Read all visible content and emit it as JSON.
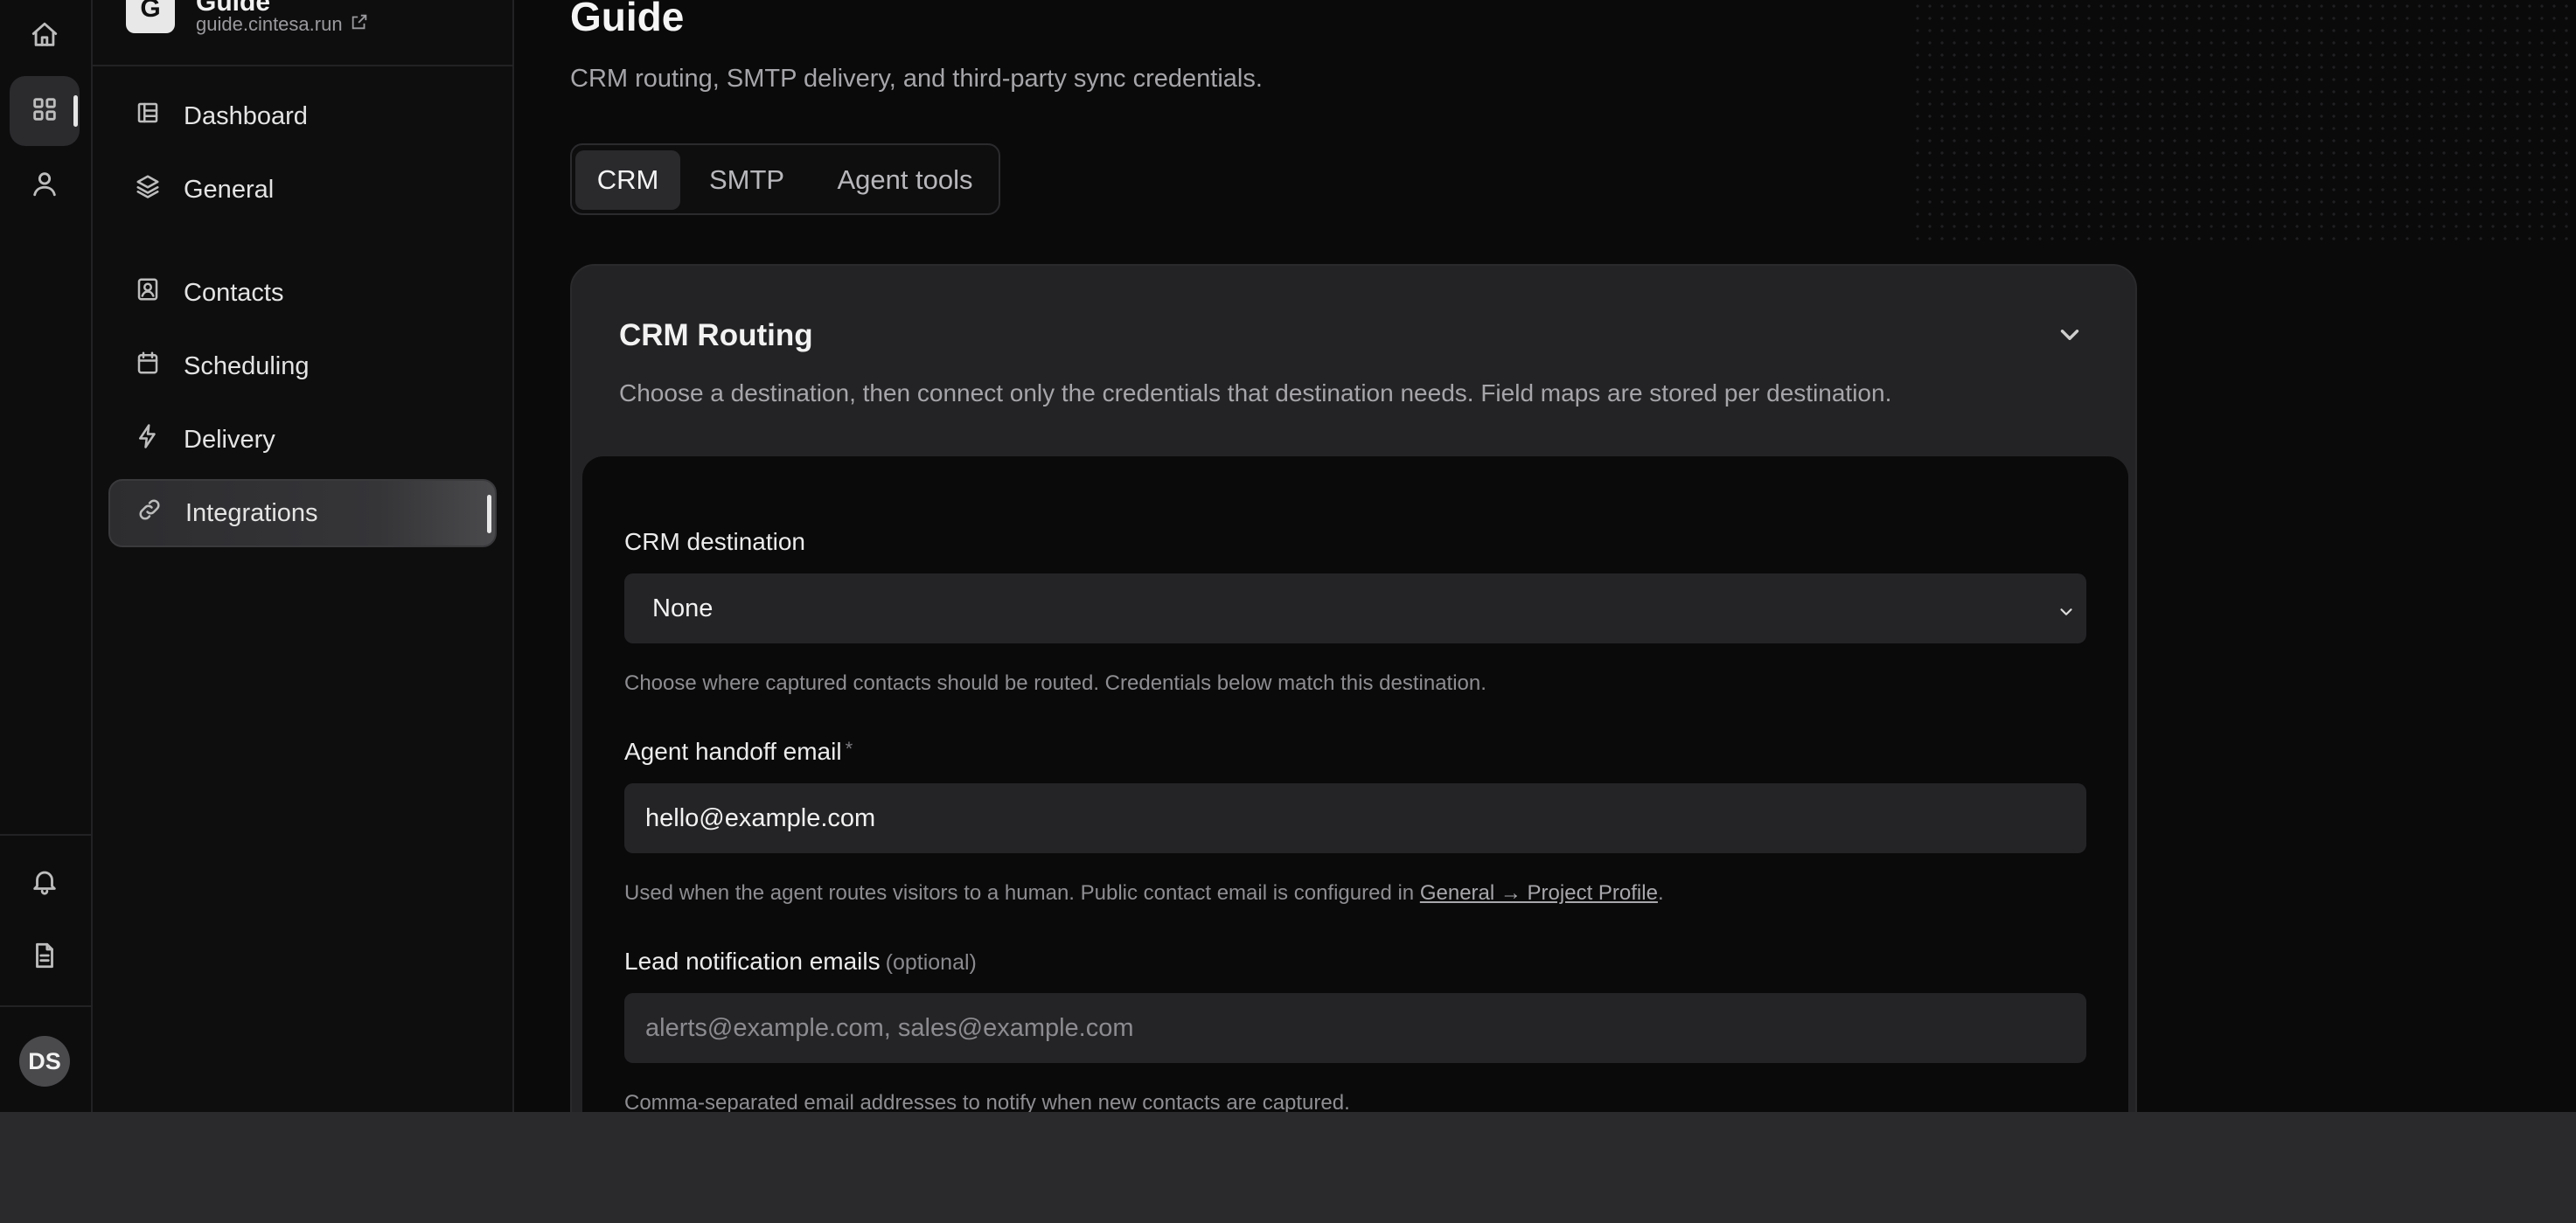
{
  "rail": {
    "avatar_initials": "DS",
    "icons": [
      "home-icon",
      "grid-icon",
      "user-icon",
      "bell-icon",
      "document-icon"
    ]
  },
  "sidebar": {
    "site_name": "Guide",
    "site_url": "guide.cintesa.run",
    "logo_text": "G",
    "items": [
      {
        "label": "Dashboard",
        "icon": "dashboard-icon"
      },
      {
        "label": "General",
        "icon": "layers-icon"
      },
      {
        "label": "Contacts",
        "icon": "contact-icon"
      },
      {
        "label": "Scheduling",
        "icon": "calendar-icon"
      },
      {
        "label": "Delivery",
        "icon": "bolt-icon"
      },
      {
        "label": "Integrations",
        "icon": "link-icon",
        "active": true
      }
    ]
  },
  "main": {
    "title": "Guide",
    "subtitle": "CRM routing, SMTP delivery, and third-party sync credentials.",
    "tabs": [
      {
        "label": "CRM",
        "active": true
      },
      {
        "label": "SMTP"
      },
      {
        "label": "Agent tools"
      }
    ],
    "card": {
      "title": "CRM Routing",
      "description": "Choose a destination, then connect only the credentials that destination needs. Field maps are stored per destination.",
      "fields": {
        "destination": {
          "label": "CRM destination",
          "value": "None",
          "help": "Choose where captured contacts should be routed. Credentials below match this destination."
        },
        "handoff": {
          "label": "Agent handoff email",
          "required_mark": "*",
          "value": "hello@example.com",
          "help_prefix": "Used when the agent routes visitors to a human. Public contact email is configured in ",
          "help_link": "General → Project Profile",
          "help_suffix": "."
        },
        "notifications": {
          "label": "Lead notification emails",
          "optional": "(optional)",
          "placeholder": "alerts@example.com, sales@example.com",
          "help": "Comma-separated email addresses to notify when new contacts are captured."
        }
      }
    }
  },
  "colors": {
    "background": "#0a0a0b",
    "card": "#232325",
    "input": "#242427",
    "accent_active": "#e8e8e8"
  }
}
